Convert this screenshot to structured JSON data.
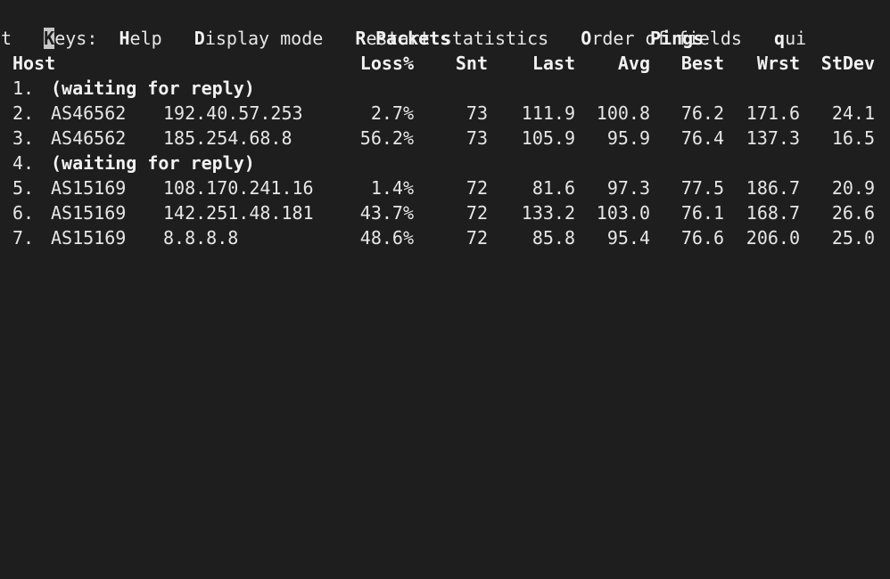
{
  "keys_bar": {
    "prefix_cursor": "K",
    "prefix_rest": "eys:",
    "help_key": "H",
    "help_rest": "elp",
    "display_key": "D",
    "display_rest": "isplay mode",
    "restart_key": "R",
    "restart_rest": "estart statistics",
    "order_key": "O",
    "order_rest": "rder of fields",
    "quit_key": "q",
    "quit_rest_line1": "ui",
    "quit_rest_line2": "t"
  },
  "section_headers": {
    "packets": "Packets",
    "pings": "Pings"
  },
  "columns": {
    "host": "Host",
    "loss": "Loss%",
    "snt": "Snt",
    "last": "Last",
    "avg": "Avg",
    "best": "Best",
    "wrst": "Wrst",
    "stdev": "StDev"
  },
  "hops": [
    {
      "num": "1.",
      "waiting": "(waiting for reply)"
    },
    {
      "num": "2.",
      "asn": "AS46562",
      "ip": "192.40.57.253",
      "loss": "2.7%",
      "snt": "73",
      "last": "111.9",
      "avg": "100.8",
      "best": "76.2",
      "wrst": "171.6",
      "stdev": "24.1"
    },
    {
      "num": "3.",
      "asn": "AS46562",
      "ip": "185.254.68.8",
      "loss": "56.2%",
      "snt": "73",
      "last": "105.9",
      "avg": "95.9",
      "best": "76.4",
      "wrst": "137.3",
      "stdev": "16.5"
    },
    {
      "num": "4.",
      "waiting": "(waiting for reply)"
    },
    {
      "num": "5.",
      "asn": "AS15169",
      "ip": "108.170.241.16",
      "loss": "1.4%",
      "snt": "72",
      "last": "81.6",
      "avg": "97.3",
      "best": "77.5",
      "wrst": "186.7",
      "stdev": "20.9"
    },
    {
      "num": "6.",
      "asn": "AS15169",
      "ip": "142.251.48.181",
      "loss": "43.7%",
      "snt": "72",
      "last": "133.2",
      "avg": "103.0",
      "best": "76.1",
      "wrst": "168.7",
      "stdev": "26.6"
    },
    {
      "num": "7.",
      "asn": "AS15169",
      "ip": "8.8.8.8",
      "loss": "48.6%",
      "snt": "72",
      "last": "85.8",
      "avg": "95.4",
      "best": "76.6",
      "wrst": "206.0",
      "stdev": "25.0"
    }
  ]
}
